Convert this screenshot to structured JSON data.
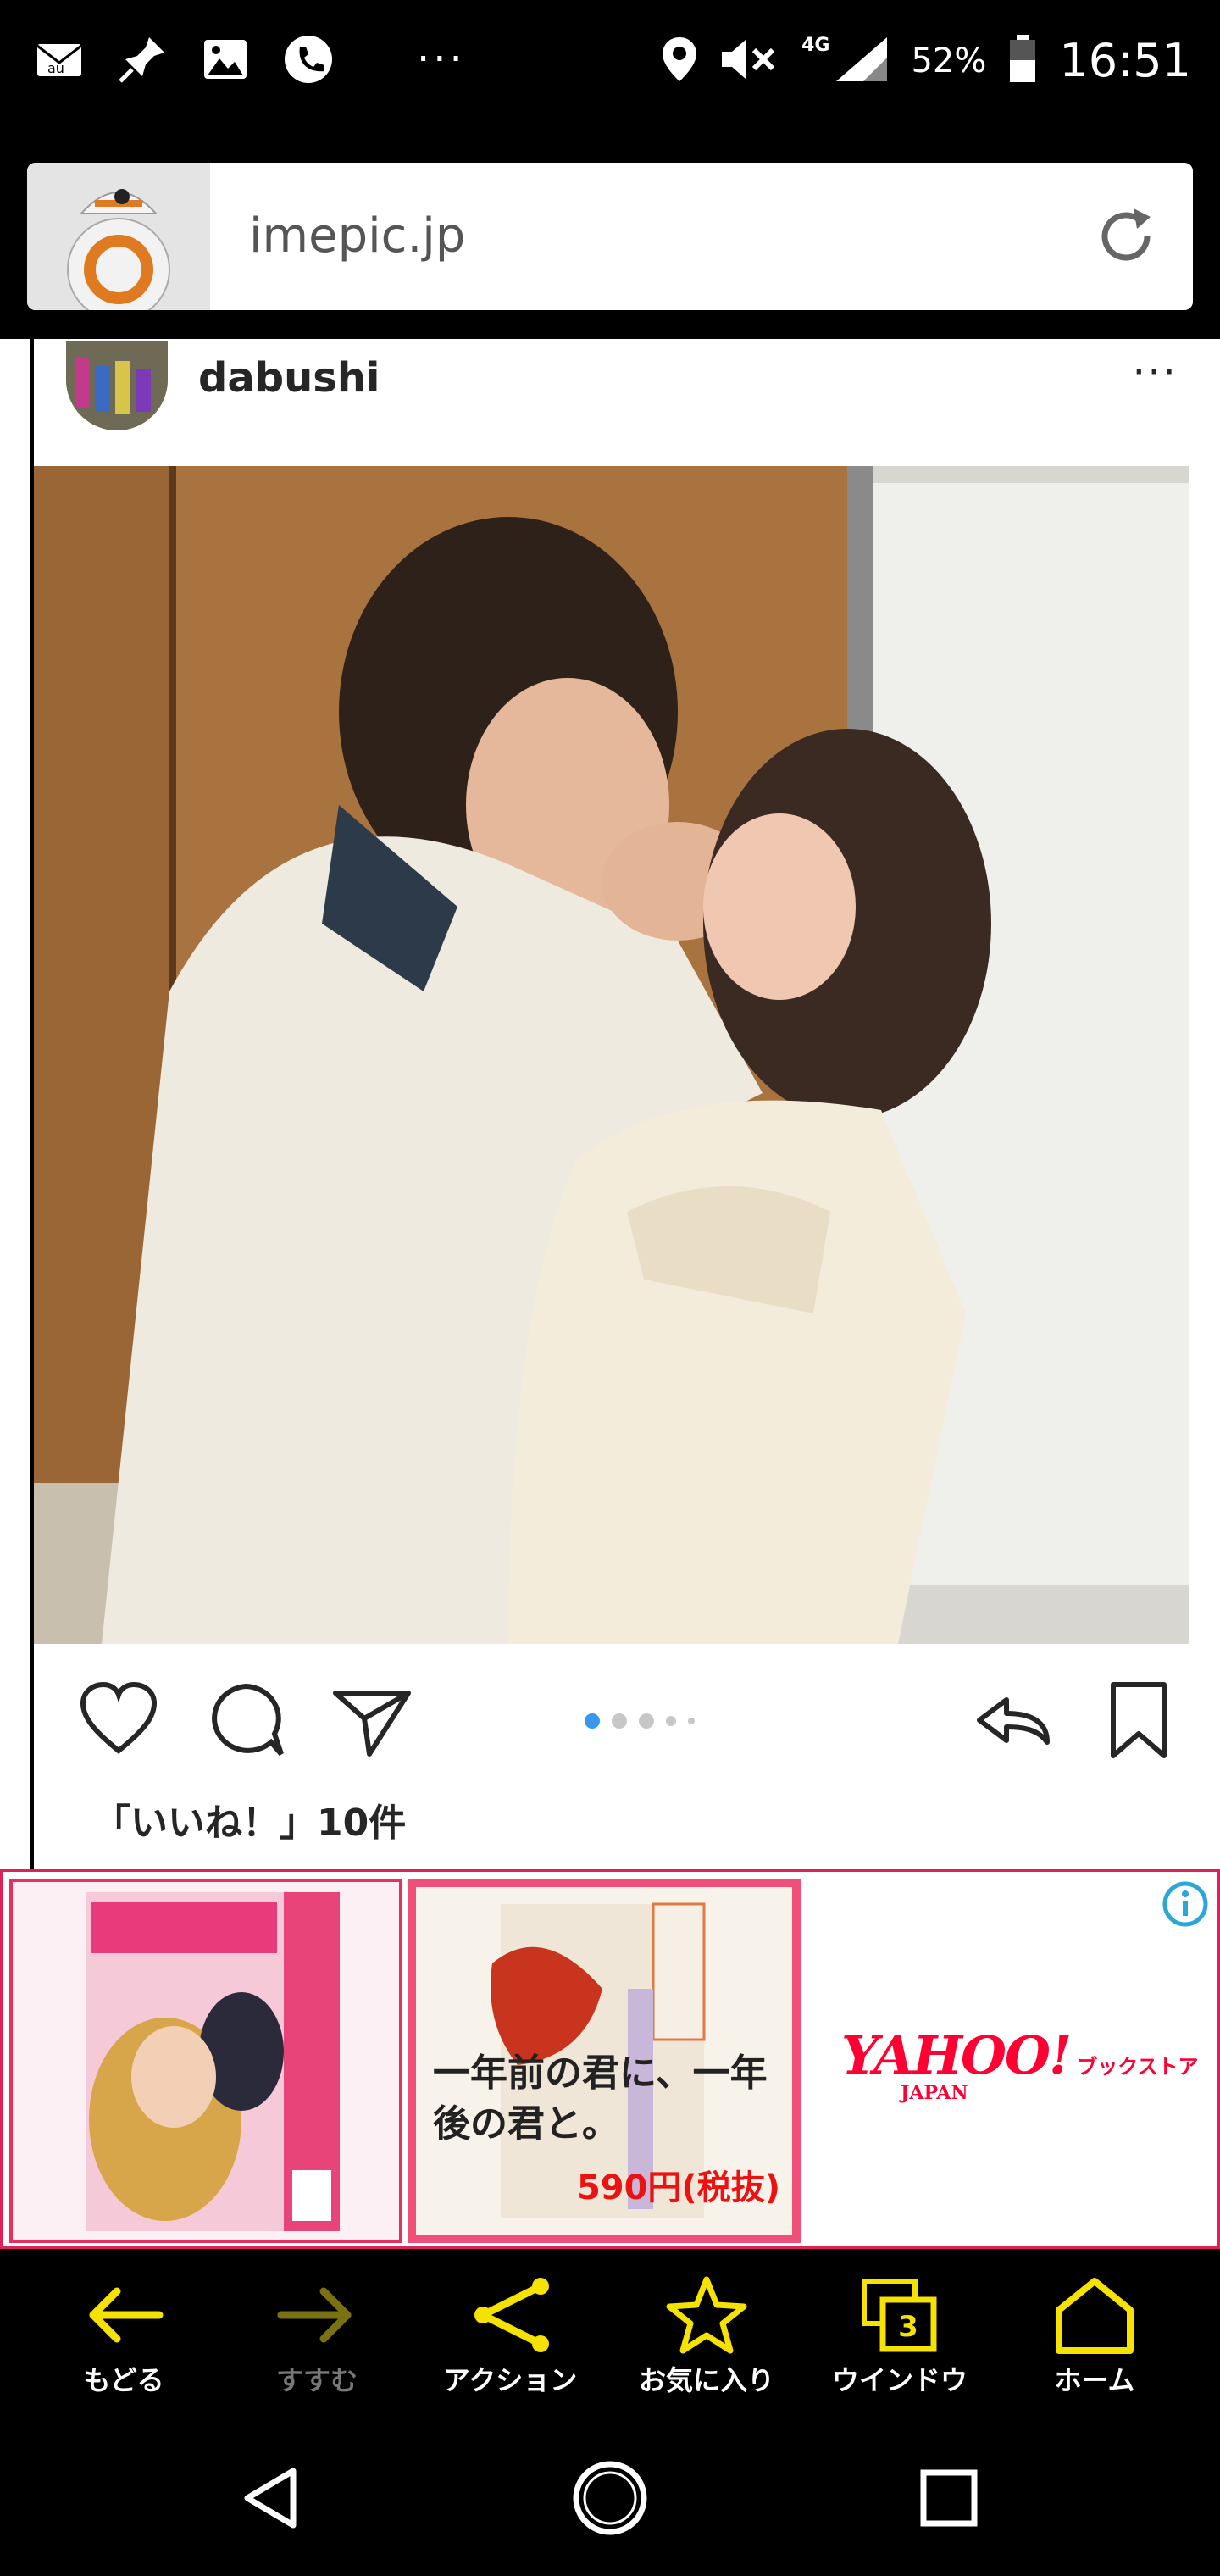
{
  "status_bar": {
    "network": "4G",
    "battery": "52%",
    "time": "16:51",
    "dots": "···",
    "icons": [
      "au-mail-icon",
      "pin-app-icon",
      "image-icon",
      "phone-icon",
      "location-icon",
      "mute-icon",
      "signal-icon",
      "battery-icon"
    ]
  },
  "address_bar": {
    "url": "imepic.jp",
    "reload_icon": "reload-icon"
  },
  "post": {
    "username": "dabushi",
    "more": "···",
    "likes": "「いいね！」10件",
    "carousel_total": 5,
    "carousel_active": 1
  },
  "ad": {
    "item2_title": "一年前の君に、一年後の君と。",
    "item2_price": "590円(税抜)",
    "brand": "YAHOO!",
    "brand_sub": "ブックストア",
    "brand_japan": "JAPAN",
    "colors": {
      "accent": "#e83060",
      "price": "#ee1111",
      "yahoo": "#ff0033"
    }
  },
  "toolbar": {
    "items": [
      {
        "label": "もどる",
        "icon": "back-arrow-icon"
      },
      {
        "label": "すすむ",
        "icon": "forward-arrow-icon"
      },
      {
        "label": "アクション",
        "icon": "share-icon"
      },
      {
        "label": "お気に入り",
        "icon": "star-icon"
      },
      {
        "label": "ウインドウ",
        "icon": "windows-icon",
        "count": "3"
      },
      {
        "label": "ホーム",
        "icon": "home-icon"
      }
    ],
    "accent": "#f5e200"
  },
  "nav": {
    "buttons": [
      "nav-back-icon",
      "nav-home-icon",
      "nav-recents-icon"
    ]
  }
}
